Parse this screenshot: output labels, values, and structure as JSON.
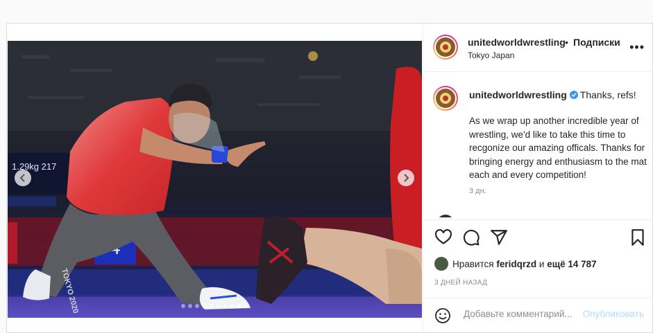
{
  "post": {
    "username": "unitedworldwrestling",
    "separator": "•",
    "follow_label": "Подписки",
    "location": "Tokyo Japan",
    "more_label": "•••",
    "caption_title": "Thanks, refs!",
    "caption_body": "As we wrap up another incredible year of wrestling, we'd like to take this time to recgonize our amazing officals. Thanks for bringing energy and enthusiasm to the mat each and every competition!",
    "caption_time": "3 дн.",
    "likes_prefix": "Нравится",
    "likes_user": "feridqrzd",
    "likes_and": "и",
    "likes_more": "ещё 14 787",
    "date": "3 ДНЕЙ НАЗАД",
    "comment_placeholder": "Добавьте комментарий...",
    "publish_label": "Опубликовать"
  },
  "photo": {
    "scoreboard_text": "1.29kg 217",
    "shirt_text": "TOKYO 2020",
    "board_number": "4"
  },
  "carousel": {
    "dot_count": 10,
    "active_index": 8
  },
  "icons": [
    "chevron-left-icon",
    "chevron-right-icon",
    "heart-icon",
    "comment-icon",
    "share-icon",
    "bookmark-icon",
    "emoji-icon",
    "verified-icon",
    "more-icon"
  ],
  "colors": {
    "accent_blue": "#0095f6",
    "publish_disabled": "#b3dbff",
    "verified": "#3897f0",
    "muted": "#8e8e8e"
  }
}
